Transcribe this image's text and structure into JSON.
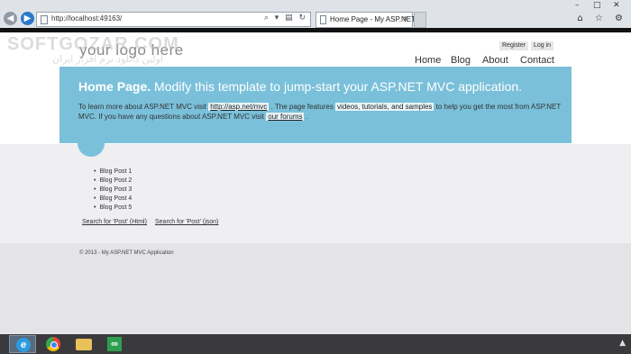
{
  "browser": {
    "address": "http://localhost:49163/",
    "tab_title": "Home Page - My ASP.NET ...",
    "tab_close": "×",
    "address_tools": "⌕ ▾ ▤ ↻",
    "window_controls": [
      "–",
      "□",
      "✕"
    ],
    "right_tools": "⌂ ☆ ⚙"
  },
  "watermark": {
    "main": "SOFTGOZAR.COM",
    "sub": "اولین دانلود نرم افزار ایران"
  },
  "site": {
    "logo": "your logo here",
    "register": "Register",
    "login": "Log in",
    "menu": [
      "Home",
      "Blog",
      "About",
      "Contact"
    ]
  },
  "featured": {
    "title_bold": "Home Page.",
    "title_rest": " Modify this template to jump-start your ASP.NET MVC application.",
    "body_1": "To learn more about ASP.NET MVC visit ",
    "link_1": "http://asp.net/mvc",
    "body_2": " . The page features ",
    "link_2": "videos, tutorials, and samples",
    "body_3": " to help you get the most from ASP.NET MVC. If you have any questions about ASP.NET MVC visit ",
    "link_3": "our forums",
    "body_4": " ."
  },
  "posts": [
    "Blog Post 1",
    "Blog Post 2",
    "Blog Post 3",
    "Blog Post 4",
    "Blog Post 5"
  ],
  "search_links": [
    "Search for 'Post' (Html)",
    "Search for 'Post' (json)"
  ],
  "footer": {
    "copyright": "© 2013 - My ASP.NET MVC Application"
  },
  "taskbar": {
    "items": [
      "internet-explorer",
      "chrome",
      "file-explorer",
      "visual-studio"
    ],
    "tray": "▲"
  },
  "colors": {
    "featured_bg": "#7ac0da",
    "page_bg": "#ffffff",
    "content_bg": "#efeef1",
    "taskbar": "#3a3a3c"
  }
}
